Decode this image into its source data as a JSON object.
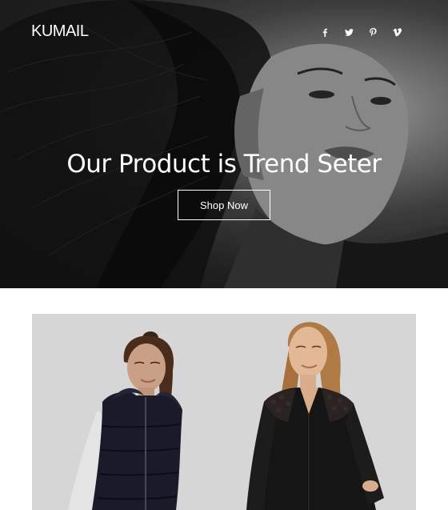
{
  "brand": {
    "logo_text": "KUMAIL"
  },
  "social": {
    "items": [
      {
        "name": "facebook-icon",
        "glyph": "f"
      },
      {
        "name": "twitter-icon",
        "glyph": "t"
      },
      {
        "name": "pinterest-icon",
        "glyph": "p"
      },
      {
        "name": "vimeo-icon",
        "glyph": "v"
      }
    ]
  },
  "hero": {
    "headline": "Our Product is Trend Seter",
    "cta_label": "Shop Now"
  },
  "colors": {
    "hero_text": "#ffffff",
    "page_bg": "#ffffff",
    "product_bg": "#d6d6d6"
  }
}
